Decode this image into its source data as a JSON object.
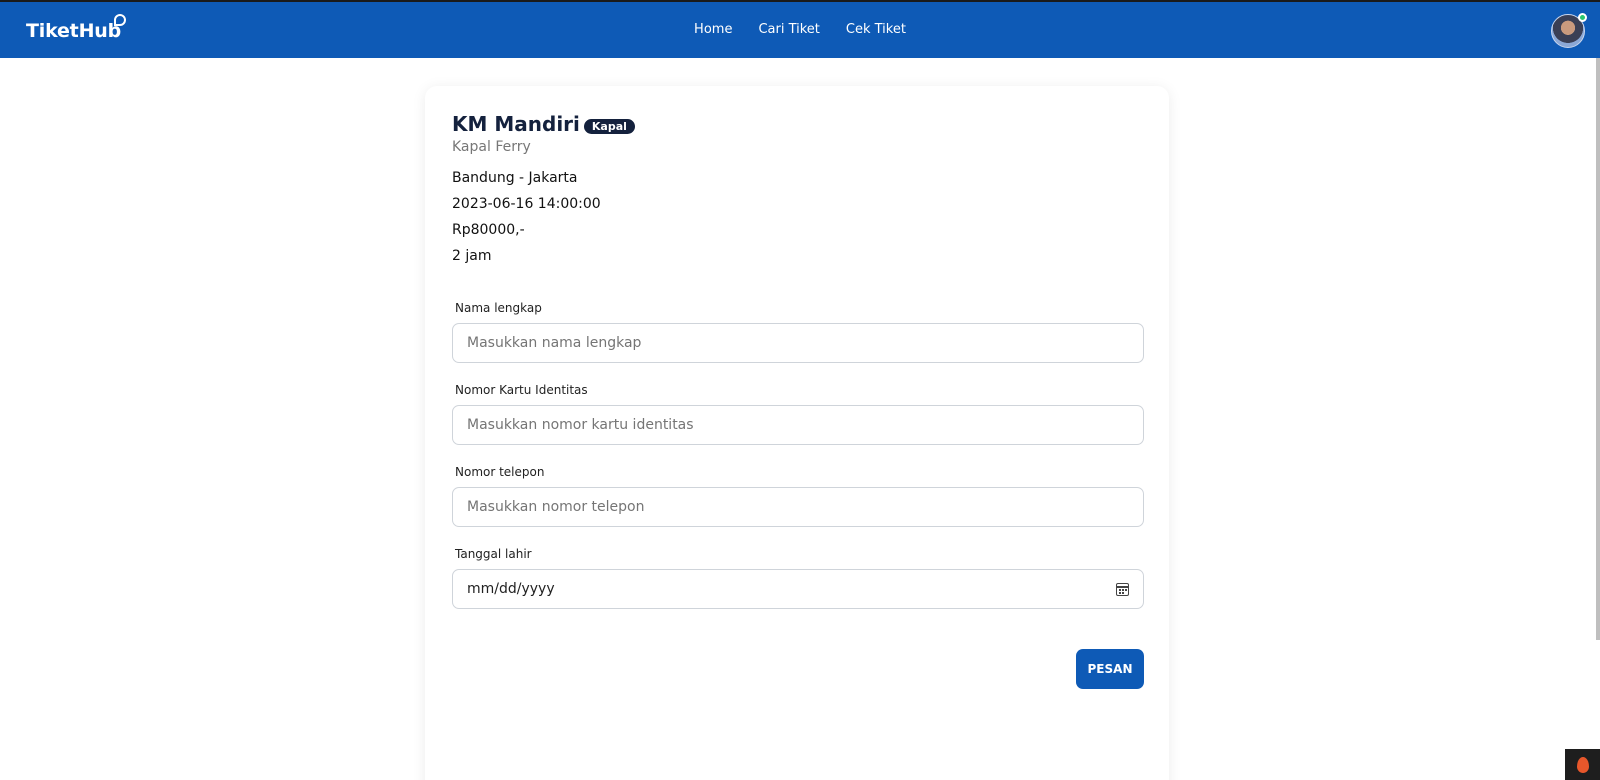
{
  "nav": {
    "logo": "TiketHub",
    "links": [
      "Home",
      "Cari Tiket",
      "Cek Tiket"
    ]
  },
  "ticket": {
    "name": "KM Mandiri",
    "badge": "Kapal",
    "type": "Kapal Ferry",
    "route": "Bandung - Jakarta",
    "datetime": "2023-06-16 14:00:00",
    "price": "Rp80000,-",
    "duration": "2 jam"
  },
  "form": {
    "name_label": "Nama lengkap",
    "name_placeholder": "Masukkan nama lengkap",
    "id_label": "Nomor Kartu Identitas",
    "id_placeholder": "Masukkan nomor kartu identitas",
    "phone_label": "Nomor telepon",
    "phone_placeholder": "Masukkan nomor telepon",
    "dob_label": "Tanggal lahir",
    "dob_placeholder": "mm/dd/yyyy",
    "submit_label": "PESAN"
  },
  "colors": {
    "primary": "#0e5ab6",
    "title": "#14213d"
  }
}
